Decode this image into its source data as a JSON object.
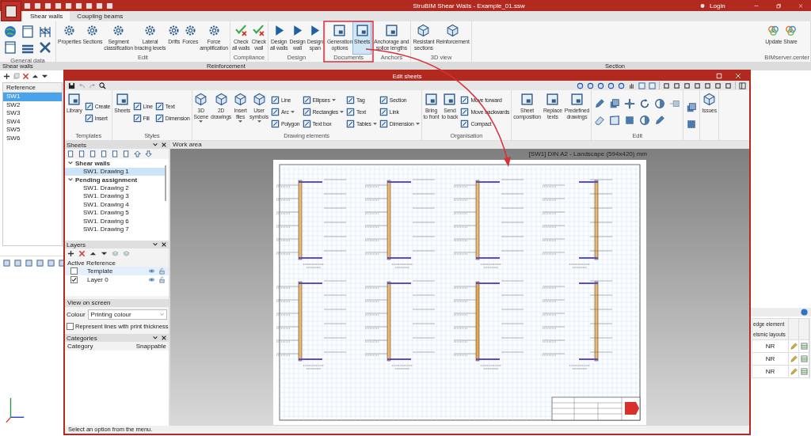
{
  "window": {
    "title": "StruBIM Shear Walls - Example_01.ssw",
    "login": "Login"
  },
  "tabs": [
    {
      "label": "Shear walls",
      "selected": true
    },
    {
      "label": "Coupling beams",
      "selected": false
    }
  ],
  "ribbon": {
    "groups": [
      {
        "label": "General data",
        "kind": "icons"
      },
      {
        "label": "Edit",
        "kind": "buttons",
        "buttons": [
          {
            "label": "Properties",
            "selected": false
          },
          {
            "label": "Sections",
            "selected": false
          },
          {
            "label": "Segment\nclassification",
            "selected": false
          },
          {
            "label": "Lateral\nbracing levels",
            "selected": false
          },
          {
            "label": "Drifts",
            "selected": false
          },
          {
            "label": "Forces",
            "selected": false
          },
          {
            "label": "Force\namplification",
            "selected": false
          }
        ]
      },
      {
        "label": "Compliance",
        "kind": "buttons",
        "buttons": [
          {
            "label": "Check\nall walls",
            "selected": false
          },
          {
            "label": "Check\nwall",
            "selected": false
          }
        ]
      },
      {
        "label": "Design",
        "kind": "buttons",
        "buttons": [
          {
            "label": "Design\nall walls",
            "selected": false
          },
          {
            "label": "Design\nwall",
            "selected": false
          },
          {
            "label": "Design\nspan",
            "selected": false
          }
        ]
      },
      {
        "label": "Documents",
        "kind": "buttons",
        "buttons": [
          {
            "label": "Generation\noptions",
            "selected": false
          },
          {
            "label": "Sheets",
            "selected": true
          }
        ]
      },
      {
        "label": "Anchors",
        "kind": "buttons",
        "buttons": [
          {
            "label": "Anchorage and\nsplice lengths",
            "selected": false
          }
        ]
      },
      {
        "label": "3D view",
        "kind": "buttons",
        "buttons": [
          {
            "label": "Resistant\nsections",
            "selected": false
          },
          {
            "label": "Reinforcement",
            "selected": false
          }
        ]
      },
      {
        "label": "BIMserver.center",
        "kind": "buttons",
        "buttons": [
          {
            "label": "Update",
            "selected": false
          },
          {
            "label": "Share",
            "selected": false
          }
        ]
      }
    ]
  },
  "panels": [
    {
      "title": "Shear walls"
    },
    {
      "title": "Reinforcement"
    },
    {
      "title": "Section"
    }
  ],
  "walls_table": {
    "column": "Reference",
    "rows": [
      {
        "label": "SW1",
        "selected": true
      },
      {
        "label": "SW2",
        "selected": false
      },
      {
        "label": "SW3",
        "selected": false
      },
      {
        "label": "SW4",
        "selected": false
      },
      {
        "label": "SW5",
        "selected": false
      },
      {
        "label": "SW6",
        "selected": false
      }
    ]
  },
  "section_table": {
    "headers": [
      "edge element",
      "eismic layouts"
    ],
    "rows": [
      {
        "value": "NR"
      },
      {
        "value": "NR"
      },
      {
        "value": "NR"
      }
    ]
  },
  "dialog": {
    "title": "Edit sheets",
    "groups": [
      {
        "label": "Templates",
        "columns": [
          [
            {
              "kind": "large",
              "label": "Library"
            }
          ],
          [
            {
              "kind": "small",
              "label": "Create"
            },
            {
              "kind": "small",
              "label": "Insert"
            }
          ]
        ]
      },
      {
        "label": "Styles",
        "columns": [
          [
            {
              "kind": "large",
              "label": "Sheets"
            }
          ],
          [
            {
              "kind": "small",
              "label": "Line"
            },
            {
              "kind": "small",
              "label": "Fill"
            }
          ],
          [
            {
              "kind": "small",
              "label": "Text"
            },
            {
              "kind": "small",
              "label": "Dimension"
            }
          ]
        ]
      },
      {
        "label": "Drawing elements",
        "columns": [
          [
            {
              "kind": "large",
              "label": "3D\nScene",
              "dropdown": true
            }
          ],
          [
            {
              "kind": "large",
              "label": "2D\ndrawings"
            }
          ],
          [
            {
              "kind": "large",
              "label": "Insert\nfiles",
              "dropdown": true
            }
          ],
          [
            {
              "kind": "large",
              "label": "User\nsymbols",
              "dropdown": true
            }
          ],
          [
            {
              "kind": "small",
              "label": "Line"
            },
            {
              "kind": "small",
              "label": "Arc",
              "dropdown": true
            },
            {
              "kind": "small",
              "label": "Polygon"
            }
          ],
          [
            {
              "kind": "small",
              "label": "Ellipses",
              "dropdown": true
            },
            {
              "kind": "small",
              "label": "Rectangles",
              "dropdown": true
            },
            {
              "kind": "small",
              "label": "Text box"
            }
          ],
          [
            {
              "kind": "small",
              "label": "Tag"
            },
            {
              "kind": "small",
              "label": "Text"
            },
            {
              "kind": "small",
              "label": "Tables",
              "dropdown": true
            }
          ],
          [
            {
              "kind": "small",
              "label": "Section"
            },
            {
              "kind": "small",
              "label": "Link"
            },
            {
              "kind": "small",
              "label": "Dimension",
              "dropdown": true
            }
          ]
        ]
      },
      {
        "label": "Organisation",
        "columns": [
          [
            {
              "kind": "large",
              "label": "Bring\nto front"
            }
          ],
          [
            {
              "kind": "large",
              "label": "Send\nto back"
            }
          ],
          [
            {
              "kind": "small",
              "label": "Move forward"
            },
            {
              "kind": "small",
              "label": "Move backwards"
            },
            {
              "kind": "small",
              "label": "Compact"
            }
          ]
        ]
      },
      {
        "columns": [
          [
            {
              "kind": "large",
              "label": "Sheet\ncomposition"
            }
          ],
          [
            {
              "kind": "large",
              "label": "Replace\ntexts"
            }
          ],
          [
            {
              "kind": "large",
              "label": "Predefined\ndrawings"
            }
          ]
        ]
      },
      {
        "label": "Edit",
        "columns": [
          [
            {
              "kind": "icons"
            }
          ]
        ]
      },
      {
        "columns": [
          [
            {
              "kind": "icons2"
            }
          ]
        ]
      },
      {
        "columns": [
          [
            {
              "kind": "large",
              "label": "Issues"
            }
          ]
        ]
      }
    ],
    "sheets_panel": {
      "title": "Sheets",
      "tree": [
        {
          "label": "Shear walls",
          "expanded": true,
          "children": [
            {
              "label": "SW1. Drawing 1",
              "selected": true
            }
          ]
        },
        {
          "label": "Pending assignment",
          "expanded": true,
          "children": [
            {
              "label": "SW1. Drawing 2",
              "selected": false
            },
            {
              "label": "SW1. Drawing 3",
              "selected": false
            },
            {
              "label": "SW1. Drawing 4",
              "selected": false
            },
            {
              "label": "SW1. Drawing 5",
              "selected": false
            },
            {
              "label": "SW1. Drawing 6",
              "selected": false
            },
            {
              "label": "SW1. Drawing 7",
              "selected": false
            }
          ]
        }
      ]
    },
    "layers_panel": {
      "title": "Layers",
      "columns": [
        "Active",
        "Reference"
      ],
      "rows": [
        {
          "name": "Template",
          "checked": false,
          "selected": true
        },
        {
          "name": "Layer 0",
          "checked": true,
          "selected": false
        }
      ]
    },
    "view_on_screen": {
      "title": "View on screen",
      "colour_label": "Colour",
      "colour_value": "Printing colour",
      "thickness_label": "Represent lines with print thickness",
      "thickness_checked": false
    },
    "categories": {
      "title": "Categories",
      "columns": [
        "Category",
        "Snappable"
      ]
    },
    "work_area": {
      "title": "Work area",
      "caption": "[SW1] DIN A2 - Landscape (594x420) mm"
    },
    "status": "Select an option from the menu."
  }
}
